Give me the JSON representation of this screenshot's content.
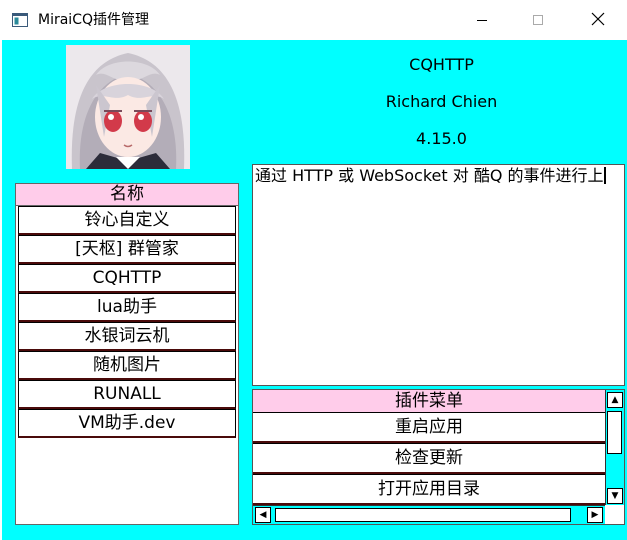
{
  "window": {
    "title": "MiraiCQ插件管理"
  },
  "plugin_info": {
    "name": "CQHTTP",
    "author": "Richard Chien",
    "version": "4.15.0",
    "description": "通过 HTTP 或 WebSocket 对 酷Q 的事件进行上"
  },
  "plugin_list": {
    "header": "名称",
    "items": [
      "铃心自定义",
      "[天枢] 群管家",
      "CQHTTP",
      "lua助手",
      "水银词云机",
      "随机图片",
      "RUNALL",
      "VM助手.dev"
    ]
  },
  "plugin_menu": {
    "header": "插件菜单",
    "items": [
      "重启应用",
      "检查更新",
      "打开应用目录"
    ]
  },
  "icons": {
    "app": "app-window-icon",
    "minimize": "minimize-icon",
    "maximize": "maximize-icon",
    "close": "close-icon",
    "scroll_up": "arrow-up-icon",
    "scroll_down": "arrow-down-icon",
    "scroll_left": "arrow-left-icon",
    "scroll_right": "arrow-right-icon"
  },
  "colors": {
    "background": "#00ffff",
    "header": "#ffccea",
    "row_border": "#4a0a0a"
  }
}
